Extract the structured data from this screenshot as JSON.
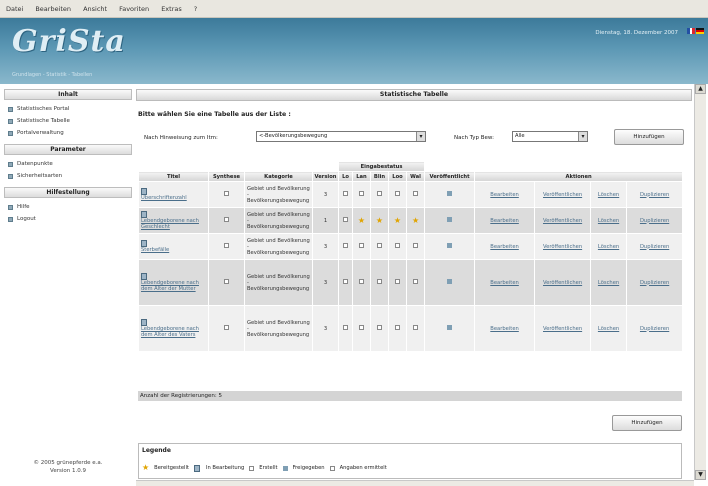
{
  "menubar": {
    "items": [
      "Datei",
      "Bearbeiten",
      "Ansicht",
      "Favoriten",
      "Extras",
      "?"
    ]
  },
  "header": {
    "logo": "GriSta",
    "tagline": "Grundlagen - Statistik - Tabellen",
    "date": "Dienstag, 18. Dezember 2007"
  },
  "sidebar": {
    "sections": [
      {
        "title": "Inhalt",
        "items": [
          "Statistisches Portal",
          "Statistische Tabelle",
          "Portalverwaltung"
        ]
      },
      {
        "title": "Parameter",
        "items": [
          "Datenpunkte",
          "Sicherheitsarten"
        ]
      },
      {
        "title": "Hilfestellung",
        "items": [
          "Hilfe",
          "Logout"
        ]
      }
    ],
    "footer_line1": "© 2005 grünepferde e.a.",
    "footer_line2": "Version 1.0.9"
  },
  "main": {
    "title": "Statistische Tabelle",
    "instruction": "Bitte wählen Sie eine Tabelle aus der Liste :",
    "filter_cat_label": "Nach Hinweisung zum Itm:",
    "filter_cat_value": "<-Bevölkerungsbewegung",
    "filter_type_label": "Nach Typ Bew:",
    "filter_type_value": "Alle",
    "button_top": "Hinzufügen",
    "button_bottom": "Hinzufügen",
    "columns": [
      "Titel",
      "Synthese",
      "Kategorie",
      "Version",
      "Lo",
      "Lan",
      "Blin",
      "Loo",
      "Wal",
      "Veröffentlicht",
      "Aktionen"
    ],
    "group_header": "Eingabestatus",
    "rows": [
      {
        "title": "Überschriftenzahl",
        "cat1": "Gebiet und Bevölkerung",
        "cat2": "Bevölkerungsbewegung",
        "version": "3",
        "stars": [
          0,
          0,
          0,
          0,
          0
        ]
      },
      {
        "title": "Lebendgeborene nach Geschlecht",
        "cat1": "Gebiet und Bevölkerung",
        "cat2": "Bevölkerungsbewegung",
        "version": "1",
        "stars": [
          0,
          1,
          1,
          1,
          1
        ]
      },
      {
        "title": "Sterbefälle",
        "cat1": "Gebiet und Bevölkerung",
        "cat2": "Bevölkerungsbewegung",
        "version": "3",
        "stars": [
          0,
          0,
          0,
          0,
          0
        ]
      },
      {
        "title": "Lebendgeborene nach dem Alter der Mutter",
        "cat1": "Gebiet und Bevölkerung",
        "cat2": "Bevölkerungsbewegung",
        "version": "3",
        "stars": [
          0,
          0,
          0,
          0,
          0
        ]
      },
      {
        "title": "Lebendgeborene nach dem Alter des Vaters",
        "cat1": "Gebiet und Bevölkerung",
        "cat2": "Bevölkerungsbewegung",
        "version": "3",
        "stars": [
          0,
          0,
          0,
          0,
          0
        ]
      }
    ],
    "actions": [
      "Bearbeiten",
      "Veröffentlichen",
      "Löschen",
      "Duplizieren"
    ],
    "count_label": "Anzahl der Registrierungen: 5",
    "legend_title": "Legende",
    "legend_items": [
      "Bereitgestellt",
      "In Bearbeitung",
      "Erstellt",
      "Freigegeben",
      "Angaben ermittelt"
    ]
  },
  "colors": {
    "header_top": "#3c7a9a",
    "header_bottom": "#8ab8cc",
    "link": "#4a6e8a",
    "star": "#e0a400"
  }
}
